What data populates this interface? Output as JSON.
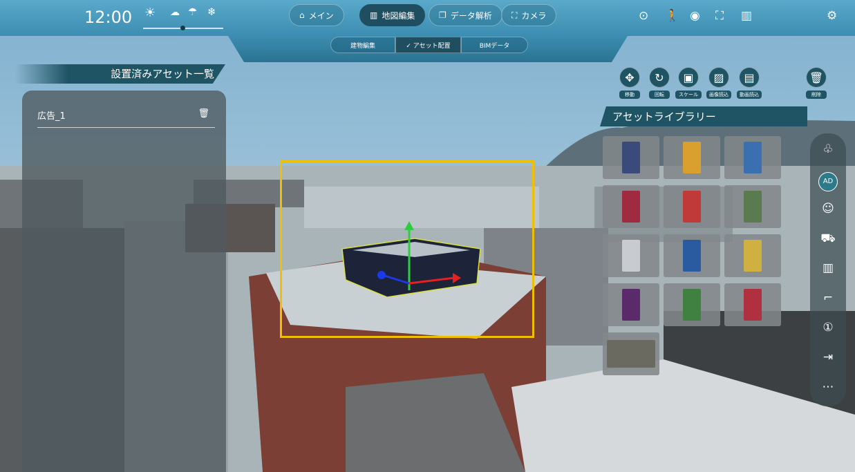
{
  "clock": "12:00",
  "weather": {
    "icons": [
      "sun-icon",
      "cloud-icon",
      "umbrella-icon",
      "snow-icon"
    ],
    "glyphs": [
      "☀",
      "☁",
      "☂",
      "❄"
    ]
  },
  "nav": [
    {
      "label": "メイン",
      "icon": "home-icon",
      "glyph": "⌂"
    },
    {
      "label": "地図編集",
      "icon": "building-icon",
      "glyph": "▥",
      "active": true
    },
    {
      "label": "データ解析",
      "icon": "layers-icon",
      "glyph": "❐"
    },
    {
      "label": "カメラ",
      "icon": "camera-icon",
      "glyph": "⛶"
    }
  ],
  "subtabs": [
    {
      "label": "建物編集"
    },
    {
      "label": "✓ アセット配置",
      "active": true
    },
    {
      "label": "BIMデータ"
    }
  ],
  "top_right_icons": [
    "location-icon",
    "walk-icon",
    "eye-icon",
    "focus-icon",
    "buildings-icon",
    "settings-icon"
  ],
  "left_panel": {
    "title": "設置済みアセット一覧",
    "items": [
      {
        "name": "広告_1"
      }
    ]
  },
  "tools": [
    {
      "label": "移動",
      "icon": "move-icon",
      "glyph": "✥"
    },
    {
      "label": "回転",
      "icon": "rotate-icon",
      "glyph": "↻"
    },
    {
      "label": "スケール",
      "icon": "scale-icon",
      "glyph": "▣"
    },
    {
      "label": "画像読込",
      "icon": "image-icon",
      "glyph": "▨"
    },
    {
      "label": "動画読込",
      "icon": "video-icon",
      "glyph": "▤"
    }
  ],
  "delete_label": "削除",
  "library": {
    "title": "アセットライブラリー",
    "count": 13
  },
  "right_bar_icons": [
    "tree-icon",
    "ad-icon",
    "person-icon",
    "car-icon",
    "building-icon",
    "streetlight-icon",
    "sign-icon",
    "import-icon",
    "more-icon"
  ],
  "right_bar_glyphs": [
    "♧",
    "AD",
    "☺",
    "⛟",
    "▥",
    "⌐",
    "①",
    "⇥",
    "⋯"
  ]
}
